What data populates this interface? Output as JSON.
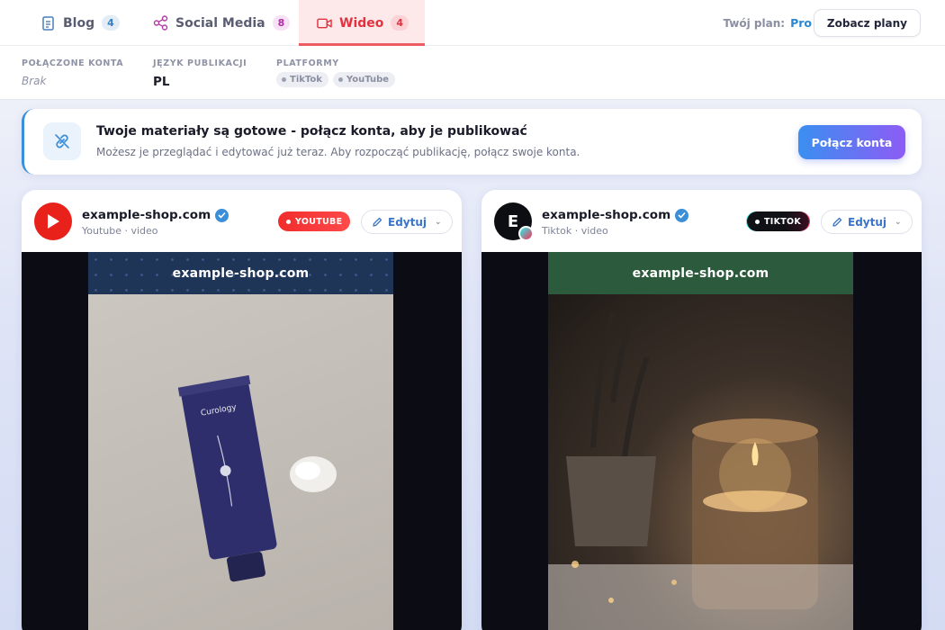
{
  "tabs": [
    {
      "label": "Blog",
      "count": "4",
      "icon": "document-icon"
    },
    {
      "label": "Social Media",
      "count": "8",
      "icon": "share-icon"
    },
    {
      "label": "Wideo",
      "count": "4",
      "icon": "video-icon"
    }
  ],
  "plan": {
    "label": "Twój plan:",
    "value": "Pro",
    "button": "Zobacz plany"
  },
  "info": {
    "accounts_label": "Połączone konta",
    "accounts_value": "Brak",
    "lang_label": "Język publikacji",
    "lang_value": "PL",
    "platforms_label": "Platformy",
    "platforms": [
      "TikTok",
      "YouTube"
    ]
  },
  "banner": {
    "title": "Twoje materiały są gotowe - połącz konta, aby je publikować",
    "subtitle": "Możesz je przeglądać i edytować już teraz. Aby rozpocząć publikację, połącz swoje konta.",
    "button": "Połącz konta",
    "icon": "link-icon"
  },
  "cards": [
    {
      "name": "example-shop.com",
      "sub": "Youtube · video",
      "badge": "YOUTUBE",
      "edit": "Edytuj",
      "overlay": "example-shop.com"
    },
    {
      "name": "example-shop.com",
      "sub": "Tiktok · video",
      "badge": "TIKTOK",
      "edit": "Edytuj",
      "overlay": "example-shop.com",
      "avatar_letter": "E"
    }
  ],
  "colors": {
    "accent": "#e3323f",
    "blue": "#3b8ed8",
    "youtube": "#e8211b"
  }
}
